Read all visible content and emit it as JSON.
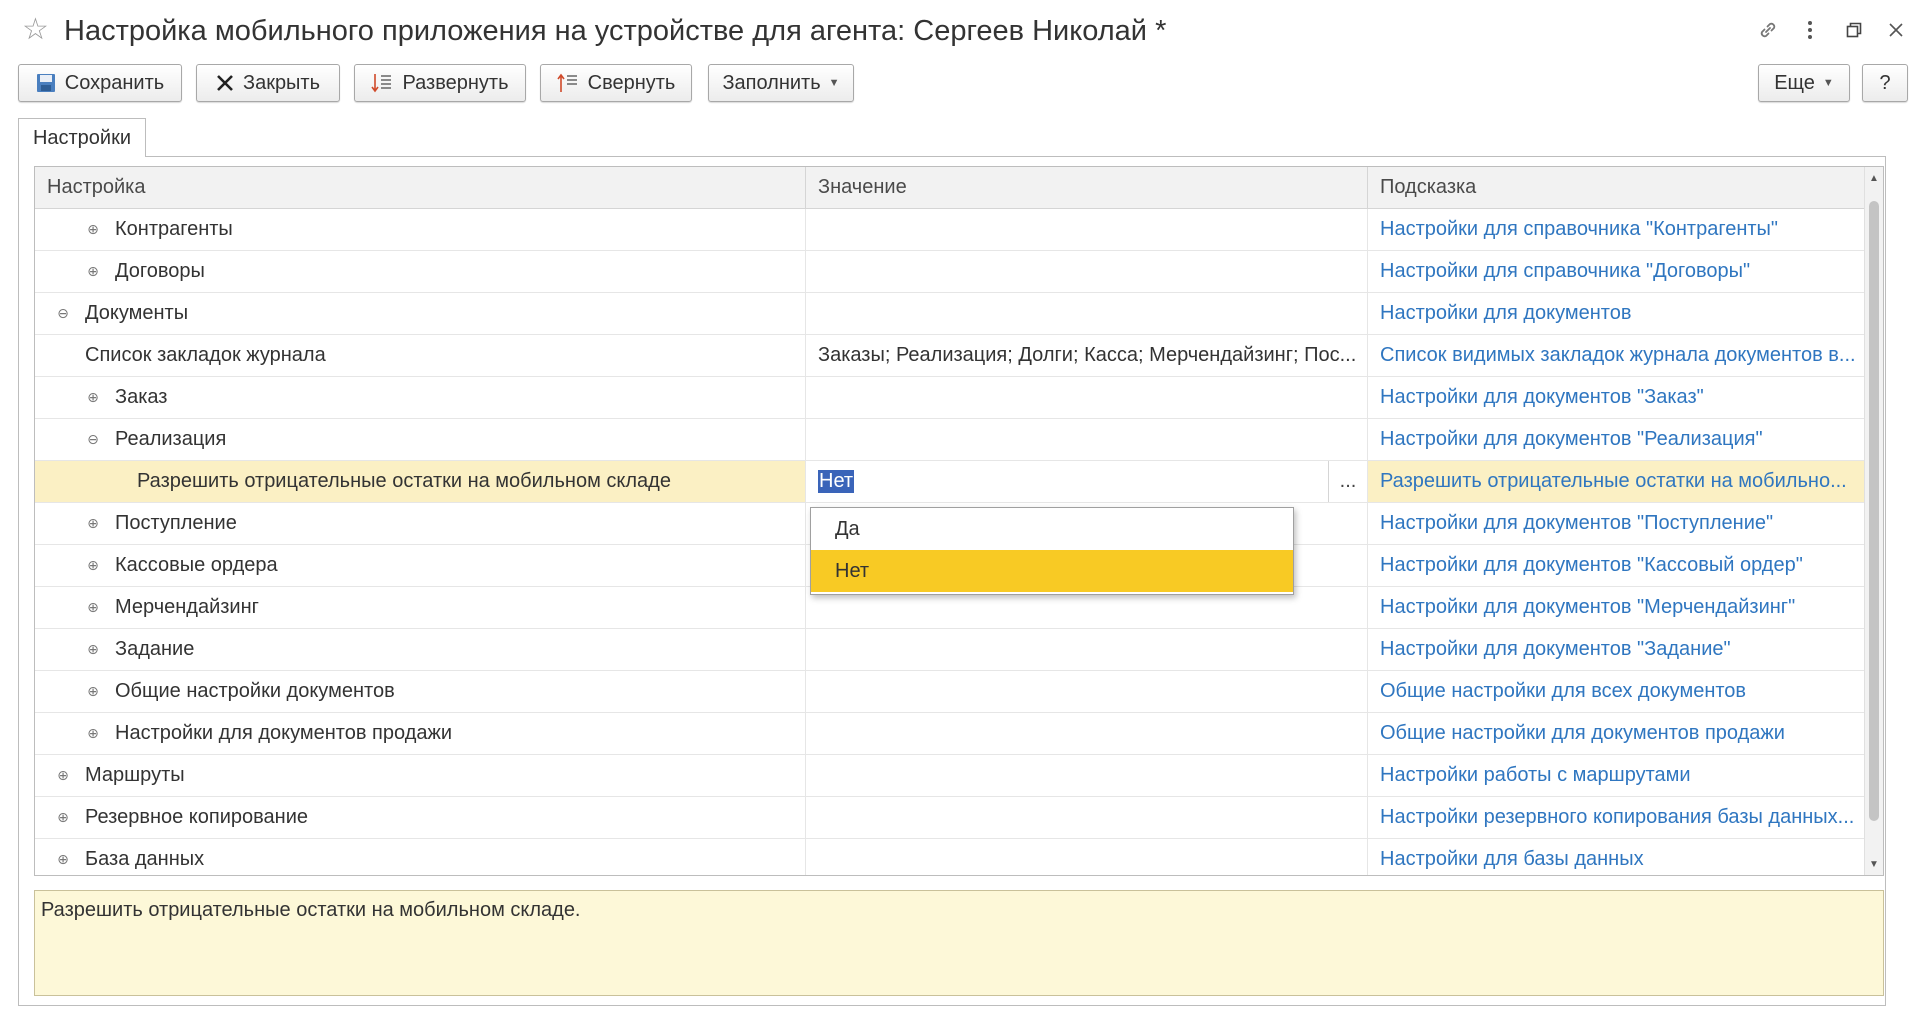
{
  "window": {
    "title": "Настройка мобильного приложения на устройстве для агента: Сергеев Николай *"
  },
  "toolbar": {
    "save_label": "Сохранить",
    "close_label": "Закрыть",
    "expand_label": "Развернуть",
    "collapse_label": "Свернуть",
    "fill_label": "Заполнить",
    "more_label": "Еще",
    "help_label": "?"
  },
  "tabs": [
    {
      "label": "Настройки"
    }
  ],
  "grid": {
    "columns": [
      "Настройка",
      "Значение",
      "Подсказка"
    ],
    "rows": [
      {
        "level": 1,
        "state": "collapsed",
        "setting": "Контрагенты",
        "value": "",
        "hint": "Настройки для справочника \"Контрагенты\""
      },
      {
        "level": 1,
        "state": "collapsed",
        "setting": "Договоры",
        "value": "",
        "hint": "Настройки для справочника \"Договоры\""
      },
      {
        "level": 0,
        "state": "expanded",
        "setting": "Документы",
        "value": "",
        "hint": "Настройки для документов"
      },
      {
        "level": 1,
        "state": "leaf",
        "setting": "Список закладок журнала",
        "value": "Заказы; Реализация; Долги; Касса; Мерчендайзинг; Пос...",
        "hint": "Список видимых закладок журнала документов в..."
      },
      {
        "level": 1,
        "state": "collapsed",
        "setting": "Заказ",
        "value": "",
        "hint": "Настройки для документов \"Заказ\""
      },
      {
        "level": 1,
        "state": "expanded",
        "setting": "Реализация",
        "value": "",
        "hint": "Настройки для документов \"Реализация\""
      },
      {
        "level": 2,
        "state": "leaf",
        "selected": true,
        "setting": "Разрешить отрицательные остатки на мобильном складе",
        "value": "Нет",
        "hint": "Разрешить отрицательные остатки на мобильно..."
      },
      {
        "level": 1,
        "state": "collapsed",
        "setting": "Поступление",
        "value": "",
        "hint": "Настройки для документов \"Поступление\""
      },
      {
        "level": 1,
        "state": "collapsed",
        "setting": "Кассовые ордера",
        "value": "",
        "hint": "Настройки для документов \"Кассовый ордер\""
      },
      {
        "level": 1,
        "state": "collapsed",
        "setting": "Мерчендайзинг",
        "value": "",
        "hint": "Настройки для документов \"Мерчендайзинг\""
      },
      {
        "level": 1,
        "state": "collapsed",
        "setting": "Задание",
        "value": "",
        "hint": "Настройки для документов \"Задание\""
      },
      {
        "level": 1,
        "state": "collapsed",
        "setting": "Общие настройки документов",
        "value": "",
        "hint": "Общие настройки для всех документов"
      },
      {
        "level": 1,
        "state": "collapsed",
        "setting": "Настройки для документов продажи",
        "value": "",
        "hint": "Общие настройки для документов продажи"
      },
      {
        "level": 0,
        "state": "collapsed",
        "setting": "Маршруты",
        "value": "",
        "hint": "Настройки работы с маршрутами"
      },
      {
        "level": 0,
        "state": "collapsed",
        "setting": "Резервное копирование",
        "value": "",
        "hint": "Настройки резервного копирования базы данных..."
      },
      {
        "level": 0,
        "state": "collapsed",
        "setting": "База данных",
        "value": "",
        "hint": "Настройки для базы данных"
      }
    ],
    "edit_button_label": "..."
  },
  "dropdown": {
    "options": [
      "Да",
      "Нет"
    ],
    "selected": "Нет"
  },
  "hint_text": "Разрешить отрицательные остатки на мобильном складе.",
  "colors": {
    "link": "#2f76c0",
    "selected_row": "#fbf0c4",
    "dropdown_active": "#f8ca24",
    "hint_bg": "#fdf8d8"
  }
}
